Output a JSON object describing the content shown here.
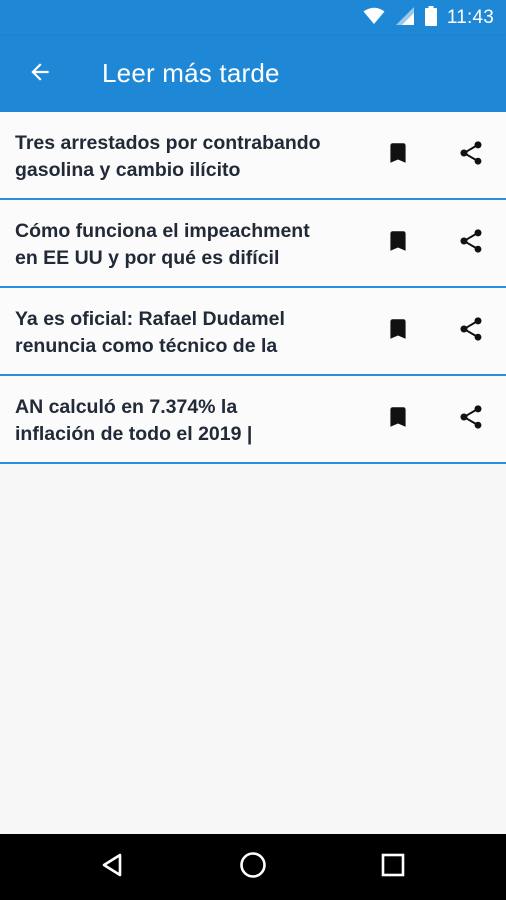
{
  "status_bar": {
    "time": "11:43",
    "icons": [
      "wifi-icon",
      "cell-signal-icon",
      "battery-icon"
    ]
  },
  "app_bar": {
    "title": "Leer más tarde",
    "back_icon": "arrow-back-icon"
  },
  "articles": [
    {
      "title": "Tres arrestados por contrabando\ngasolina y cambio ilícito",
      "bookmark_icon": "bookmark-icon",
      "share_icon": "share-icon"
    },
    {
      "title": "Cómo funciona el impeachment\nen EE UU y por qué es difícil",
      "bookmark_icon": "bookmark-icon",
      "share_icon": "share-icon"
    },
    {
      "title": "Ya es oficial: Rafael Dudamel\nrenuncia como técnico de la",
      "bookmark_icon": "bookmark-icon",
      "share_icon": "share-icon"
    },
    {
      "title": "AN calculó en 7.374% la\ninflación de todo el 2019 |",
      "bookmark_icon": "bookmark-icon",
      "share_icon": "share-icon"
    }
  ],
  "nav_bar": {
    "icons": [
      "back-triangle-icon",
      "home-circle-icon",
      "recents-square-icon"
    ]
  },
  "colors": {
    "primary": "#1e88d6",
    "divider": "#2b8fdc",
    "title_text": "#222a38",
    "background": "#f7f7f7"
  }
}
